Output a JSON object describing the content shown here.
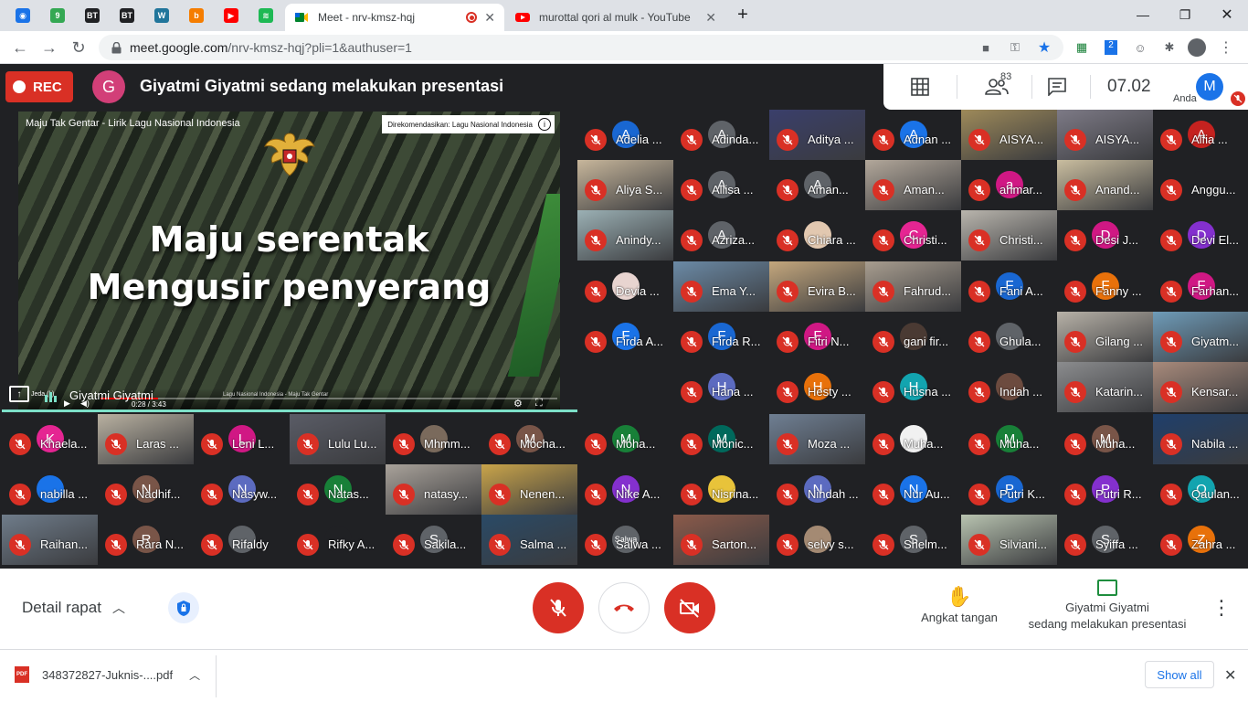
{
  "browser": {
    "pinned_tabs": [
      {
        "name": "kemendikbud",
        "color": "#1a73e8",
        "label": "◉"
      },
      {
        "name": "nine",
        "color": "#34a853",
        "label": "9"
      },
      {
        "name": "bt-1",
        "color": "#202124",
        "label": "BT"
      },
      {
        "name": "bt-2",
        "color": "#202124",
        "label": "BT"
      },
      {
        "name": "wordpress",
        "color": "#21759b",
        "label": "W"
      },
      {
        "name": "blogger",
        "color": "#f57d00",
        "label": "b"
      },
      {
        "name": "youtube",
        "color": "#ff0000",
        "label": "▶"
      },
      {
        "name": "spotify",
        "color": "#1db954",
        "label": "≋"
      }
    ],
    "tabs": [
      {
        "title": "Meet - nrv-kmsz-hqj",
        "active": true
      },
      {
        "title": "murottal qori al mulk - YouTube",
        "active": false
      }
    ],
    "url_host": "meet.google.com",
    "url_path": "/nrv-kmsz-hqj?pli=1&authuser=1"
  },
  "meet": {
    "rec_label": "REC",
    "presenter_initial": "G",
    "presenter_banner": "Giyatmi Giyatmi sedang melakukan presentasi",
    "clock": "07.02",
    "participant_count": "83",
    "self_label": "Anda",
    "self_initial": "M",
    "video": {
      "caption": "Maju Tak Gentar - Lirik Lagu Nasional Indonesia",
      "recommend": "Direkomendasikan: Lagu Nasional Indonesia",
      "lyric_line1": "Maju serentak",
      "lyric_line2": "Mengusir penyerang",
      "jeda": "Jeda (k)",
      "time": "0:28 / 3:43",
      "progress": 0.125,
      "sub_title": "Lagu Nasional Indonesia - Maju Tak Gentar"
    },
    "presenter_name": "Giyatmi Giyatmi",
    "tiles": [
      {
        "name": "Adelia ...",
        "initial": "A",
        "color": "#1967d2",
        "photo": false
      },
      {
        "name": "Adinda...",
        "initial": "A",
        "color": "#5f6368",
        "photo": false
      },
      {
        "name": "Aditya ...",
        "initial": "",
        "color": "#3a3f6b",
        "photo": true
      },
      {
        "name": "Adnan ...",
        "initial": "A",
        "color": "#1a73e8",
        "photo": false
      },
      {
        "name": "AISYA...",
        "initial": "",
        "color": "#9e8a5a",
        "photo": true
      },
      {
        "name": "AISYA...",
        "initial": "",
        "color": "#7d7a86",
        "photo": true
      },
      {
        "name": "Alfia ...",
        "initial": "A",
        "color": "#c5221f",
        "photo": false
      },
      {
        "name": "Aliya S...",
        "initial": "",
        "color": "#c7b69b",
        "photo": true
      },
      {
        "name": "Allisa ...",
        "initial": "A",
        "color": "#5f6368",
        "photo": false
      },
      {
        "name": "Aman...",
        "initial": "A",
        "color": "#5f6368",
        "photo": false
      },
      {
        "name": "Aman...",
        "initial": "",
        "color": "#b2a79a",
        "photo": true
      },
      {
        "name": "ahmar...",
        "initial": "a",
        "color": "#d01884",
        "photo": false
      },
      {
        "name": "Anand...",
        "initial": "",
        "color": "#c9bd9f",
        "photo": true
      },
      {
        "name": "Anggu...",
        "initial": "",
        "color": "#202124",
        "photo": false
      },
      {
        "name": "Anindy...",
        "initial": "",
        "color": "#9bb0b4",
        "photo": true
      },
      {
        "name": "Azriza...",
        "initial": "A",
        "color": "#5f6368",
        "photo": false
      },
      {
        "name": "Chiara ...",
        "initial": "",
        "color": "#e2c8b0",
        "photo": false
      },
      {
        "name": "Christi...",
        "initial": "C",
        "color": "#e52592",
        "photo": false
      },
      {
        "name": "Christi...",
        "initial": "",
        "color": "#b9b5ad",
        "photo": true
      },
      {
        "name": "Desi J...",
        "initial": "D",
        "color": "#d01884",
        "photo": false
      },
      {
        "name": "Devi El...",
        "initial": "D",
        "color": "#8430ce",
        "photo": false
      },
      {
        "name": "Devia ...",
        "initial": "",
        "color": "#e8d4d0",
        "photo": false
      },
      {
        "name": "Ema Y...",
        "initial": "",
        "color": "#6b8aa6",
        "photo": true
      },
      {
        "name": "Evira B...",
        "initial": "",
        "color": "#c4a77d",
        "photo": true
      },
      {
        "name": "Fahrud...",
        "initial": "",
        "color": "#a89d8f",
        "photo": true
      },
      {
        "name": "Fani A...",
        "initial": "F",
        "color": "#1967d2",
        "photo": false
      },
      {
        "name": "Fanny ...",
        "initial": "F",
        "color": "#e8710a",
        "photo": false
      },
      {
        "name": "Farhan...",
        "initial": "F",
        "color": "#d01884",
        "photo": false
      },
      {
        "name": "Firda A...",
        "initial": "F",
        "color": "#1a73e8",
        "photo": false
      },
      {
        "name": "Firda R...",
        "initial": "F",
        "color": "#1967d2",
        "photo": false
      },
      {
        "name": "Fitri N...",
        "initial": "F",
        "color": "#d01884",
        "photo": false
      },
      {
        "name": "gani fir...",
        "initial": "",
        "color": "#4a3a33",
        "photo": false
      },
      {
        "name": "Ghula...",
        "initial": "",
        "color": "#5f6368",
        "photo": false
      },
      {
        "name": "Gilang ...",
        "initial": "",
        "color": "#b7b1a7",
        "photo": true
      },
      {
        "name": "Giyatm...",
        "initial": "",
        "color": "#6e9bb8",
        "photo": true
      },
      {
        "name": "",
        "initial": "",
        "color": "#202124",
        "photo": false
      },
      {
        "name": "Hana ...",
        "initial": "H",
        "color": "#5c6bc0",
        "photo": false
      },
      {
        "name": "Hesty ...",
        "initial": "H",
        "color": "#e8710a",
        "photo": false
      },
      {
        "name": "Husna ...",
        "initial": "H",
        "color": "#12a4af",
        "photo": false
      },
      {
        "name": "Indah ...",
        "initial": "",
        "color": "#6c4b3f",
        "photo": false
      },
      {
        "name": "Katarin...",
        "initial": "",
        "color": "#8b8c8e",
        "photo": true
      },
      {
        "name": "Kensar...",
        "initial": "",
        "color": "#a88a7b",
        "photo": true
      },
      {
        "name": "Khaela...",
        "initial": "K",
        "color": "#e52592",
        "photo": false
      },
      {
        "name": "Laras ...",
        "initial": "",
        "color": "#b9b1a1",
        "photo": true
      },
      {
        "name": "Leni L...",
        "initial": "L",
        "color": "#d01884",
        "photo": false
      },
      {
        "name": "Lulu Lu...",
        "initial": "",
        "color": "#5a5c66",
        "photo": true
      },
      {
        "name": "Mhmm...",
        "initial": "",
        "color": "#7a6a5c",
        "photo": false
      },
      {
        "name": "Mocha...",
        "initial": "M",
        "color": "#795548",
        "photo": false
      },
      {
        "name": "Moha...",
        "initial": "M",
        "color": "#188038",
        "photo": false
      },
      {
        "name": "Monic...",
        "initial": "M",
        "color": "#00695c",
        "photo": false
      },
      {
        "name": "Moza ...",
        "initial": "",
        "color": "#6f7f93",
        "photo": true
      },
      {
        "name": "Muha...",
        "initial": "",
        "color": "#f1f1f1",
        "photo": false
      },
      {
        "name": "Muha...",
        "initial": "M",
        "color": "#188038",
        "photo": false
      },
      {
        "name": "Muha...",
        "initial": "M",
        "color": "#795548",
        "photo": false
      },
      {
        "name": "Nabila ...",
        "initial": "",
        "color": "#1f3f6b",
        "photo": true
      },
      {
        "name": "nabilla ...",
        "initial": "",
        "color": "#1a73e8",
        "photo": false
      },
      {
        "name": "Nadhif...",
        "initial": "N",
        "color": "#795548",
        "photo": false
      },
      {
        "name": "Nasyw...",
        "initial": "N",
        "color": "#5c6bc0",
        "photo": false
      },
      {
        "name": "Natas...",
        "initial": "N",
        "color": "#188038",
        "photo": false
      },
      {
        "name": "natasy...",
        "initial": "",
        "color": "#a9a29a",
        "photo": true
      },
      {
        "name": "Nenen...",
        "initial": "",
        "color": "#c9a44a",
        "photo": true
      },
      {
        "name": "Nike A...",
        "initial": "N",
        "color": "#8430ce",
        "photo": false
      },
      {
        "name": "Nisrina...",
        "initial": "",
        "color": "#e8c33a",
        "photo": false
      },
      {
        "name": "Nindah ...",
        "initial": "N",
        "color": "#5c6bc0",
        "photo": false
      },
      {
        "name": "Nur Au...",
        "initial": "N",
        "color": "#1a73e8",
        "photo": false
      },
      {
        "name": "Putri K...",
        "initial": "P",
        "color": "#1967d2",
        "photo": false
      },
      {
        "name": "Putri R...",
        "initial": "P",
        "color": "#8430ce",
        "photo": false
      },
      {
        "name": "Qaulan...",
        "initial": "Q",
        "color": "#12a4af",
        "photo": false
      },
      {
        "name": "Raihan...",
        "initial": "",
        "color": "#6f7c8a",
        "photo": true
      },
      {
        "name": "Rara N...",
        "initial": "R",
        "color": "#795548",
        "photo": false
      },
      {
        "name": "Rifaldy",
        "initial": "",
        "color": "#5f6368",
        "photo": false
      },
      {
        "name": "Rifky A...",
        "initial": "",
        "color": "#202124",
        "photo": false
      },
      {
        "name": "Sakila...",
        "initial": "S",
        "color": "#5f6368",
        "photo": false
      },
      {
        "name": "Salma ...",
        "initial": "",
        "color": "#2a4a66",
        "photo": true
      },
      {
        "name": "Salwa ...",
        "initial": "Salwa",
        "color": "#5f6368",
        "photo": false
      },
      {
        "name": "Sarton...",
        "initial": "",
        "color": "#8b5a4a",
        "photo": true
      },
      {
        "name": "selvy s...",
        "initial": "",
        "color": "#a48a73",
        "photo": false
      },
      {
        "name": "Shelm...",
        "initial": "S",
        "color": "#5f6368",
        "photo": false
      },
      {
        "name": "Silviani...",
        "initial": "",
        "color": "#b8c3b0",
        "photo": true
      },
      {
        "name": "Syiffa ...",
        "initial": "S",
        "color": "#5f6368",
        "photo": false
      },
      {
        "name": "Zahra ...",
        "initial": "Z",
        "color": "#e8710a",
        "photo": false
      }
    ]
  },
  "bottom": {
    "detail_label": "Detail rapat",
    "raise_label": "Angkat tangan",
    "present_line1": "Giyatmi Giyatmi",
    "present_line2": "sedang melakukan presentasi"
  },
  "shelf": {
    "file_name": "348372827-Juknis-....pdf",
    "file_type": "PDF",
    "show_all": "Show all"
  }
}
